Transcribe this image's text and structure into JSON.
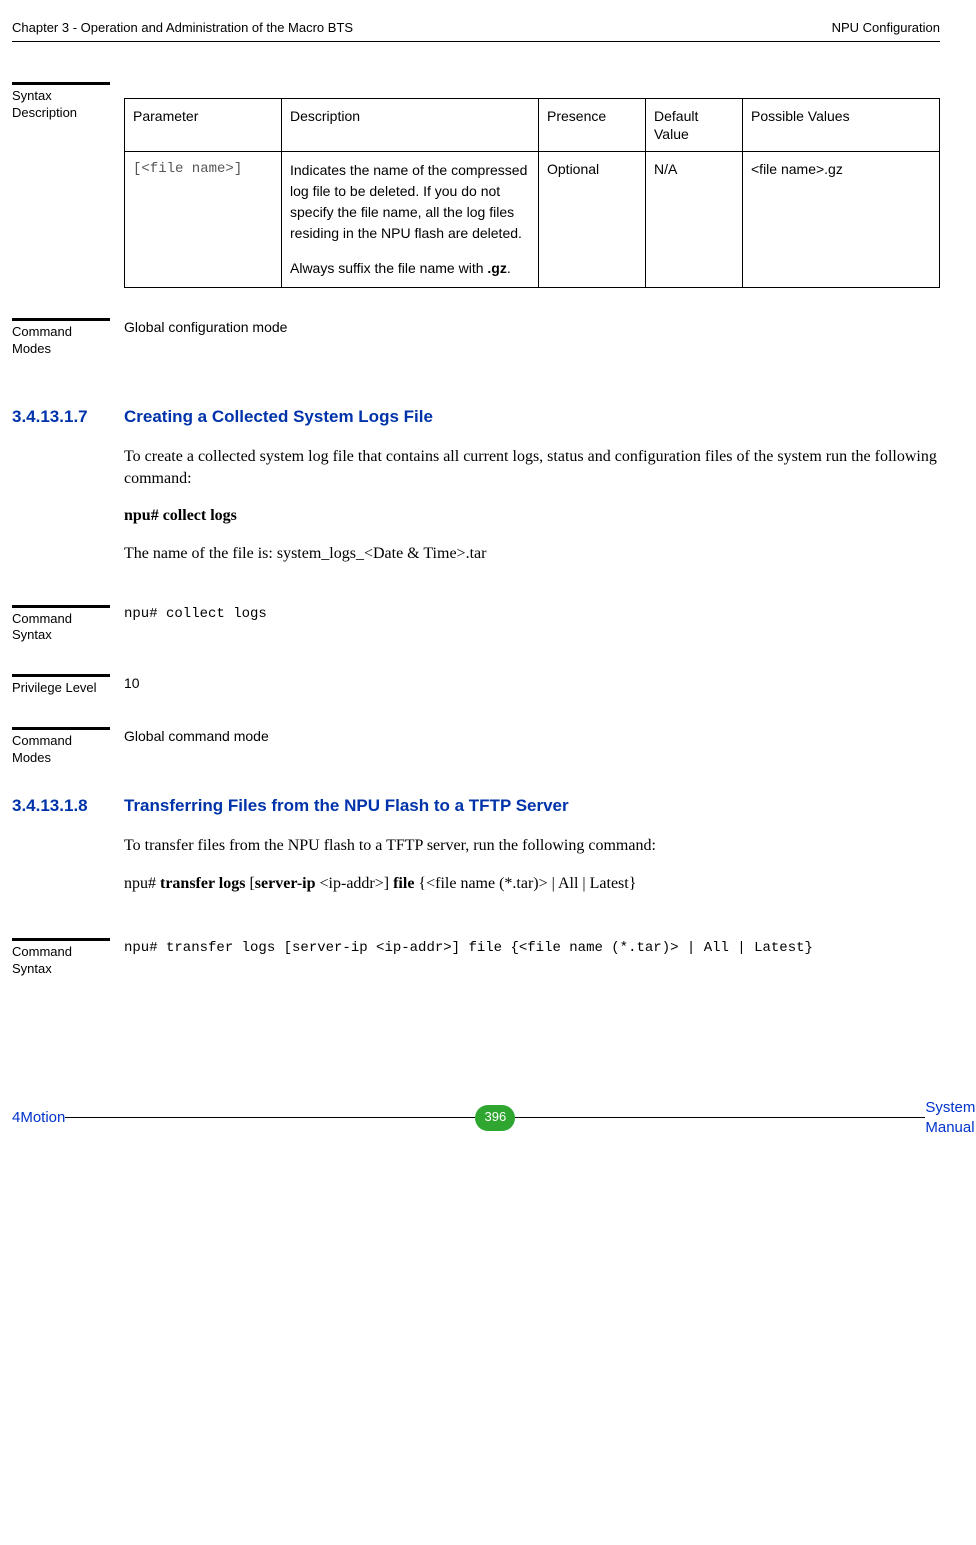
{
  "header": {
    "left": "Chapter 3 - Operation and Administration of the Macro BTS",
    "right": "NPU Configuration"
  },
  "syntax_desc_label": "Syntax Description",
  "param_table": {
    "headers": [
      "Parameter",
      "Description",
      "Presence",
      "Default Value",
      "Possible Values"
    ],
    "row": {
      "parameter": "[<file name>]",
      "description_p1": "Indicates the name of the compressed log file to be deleted. If you do not specify the file name, all the log files residing in the NPU flash are deleted.",
      "description_p2_prefix": "Always suffix the file name with ",
      "description_p2_bold": ".gz",
      "description_p2_suffix": ".",
      "presence": "Optional",
      "default": "N/A",
      "possible": "<file name>.gz"
    }
  },
  "cmd_modes_label": "Command Modes",
  "cmd_modes_1": "Global configuration mode",
  "sec1": {
    "num": "3.4.13.1.7",
    "title": "Creating a Collected System Logs File",
    "p1": "To create a collected system log file that contains all current logs, status and configuration files of the system run the following command:",
    "cmd": "npu# collect logs",
    "p2": "The name of the file is: system_logs_<Date & Time>.tar"
  },
  "cmd_syntax_label": "Command Syntax",
  "cmd_syntax_1": "npu# collect logs",
  "priv_label": "Privilege Level",
  "priv_val": "10",
  "cmd_modes_2": "Global command mode",
  "sec2": {
    "num": "3.4.13.1.8",
    "title": "Transferring Files from the NPU Flash to a TFTP Server",
    "p1": "To transfer files from the NPU flash to a TFTP server, run the following command:",
    "cmd_prefix": "npu# ",
    "cmd_b1": "transfer logs",
    "cmd_mid1": " [",
    "cmd_b2": "server-ip",
    "cmd_mid2": " <ip-addr>] ",
    "cmd_b3": "file",
    "cmd_suffix": " {<file name (*.tar)> | All | Latest}"
  },
  "cmd_syntax_2": "npu# transfer logs [server-ip <ip-addr>] file {<file name (*.tar)> | All | Latest}",
  "footer": {
    "left": "4Motion",
    "page": "396",
    "right": "System Manual"
  }
}
